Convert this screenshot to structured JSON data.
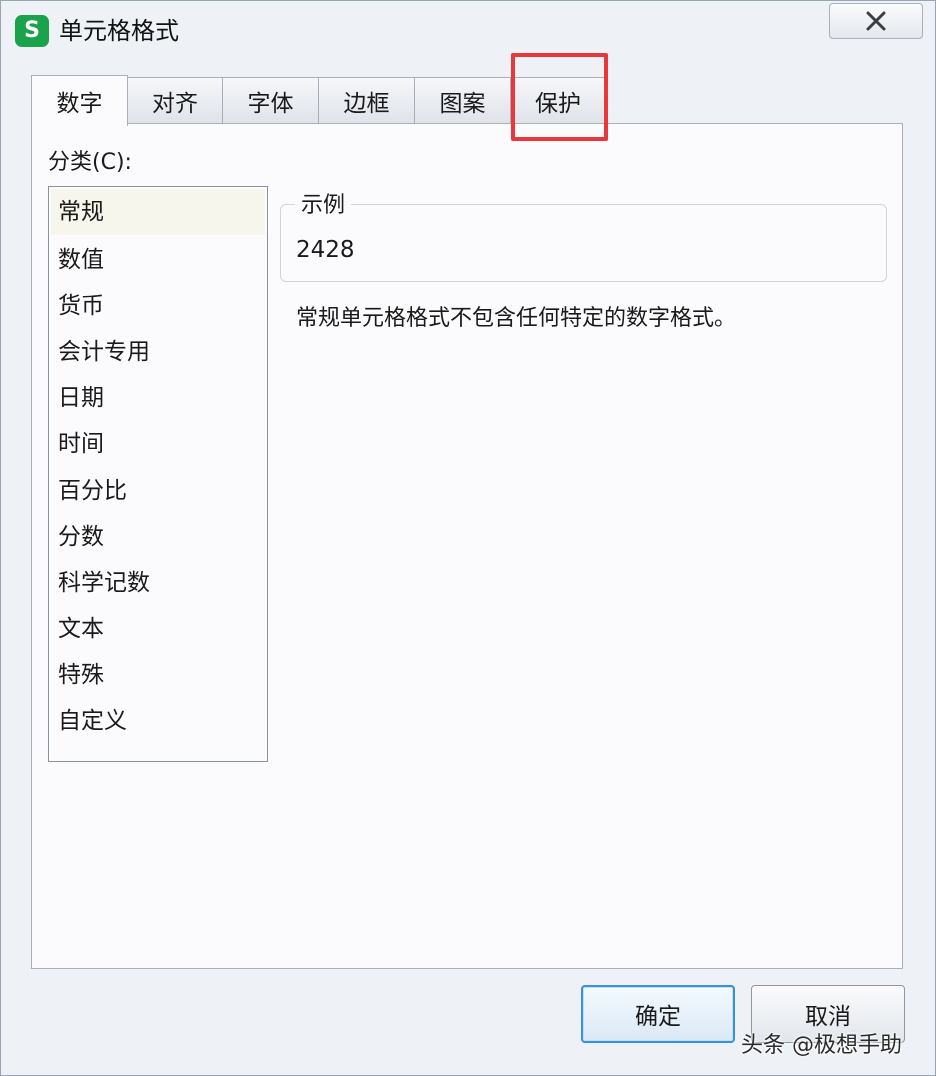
{
  "window": {
    "title": "单元格格式",
    "app_icon_letter": "S",
    "app_icon_color": "#1aa34a"
  },
  "tabs": [
    {
      "label": "数字",
      "active": true
    },
    {
      "label": "对齐",
      "active": false
    },
    {
      "label": "字体",
      "active": false
    },
    {
      "label": "边框",
      "active": false
    },
    {
      "label": "图案",
      "active": false
    },
    {
      "label": "保护",
      "active": false
    }
  ],
  "highlight": {
    "target": "保护",
    "color": "#e8383b"
  },
  "number_tab": {
    "category_label": "分类(C):",
    "categories": [
      "常规",
      "数值",
      "货币",
      "会计专用",
      "日期",
      "时间",
      "百分比",
      "分数",
      "科学记数",
      "文本",
      "特殊",
      "自定义"
    ],
    "selected_category": "常规",
    "sample_legend": "示例",
    "sample_value": "2428",
    "description": "常规单元格格式不包含任何特定的数字格式。"
  },
  "buttons": {
    "ok": "确定",
    "cancel": "取消"
  },
  "watermark": "头条 @极想手助"
}
